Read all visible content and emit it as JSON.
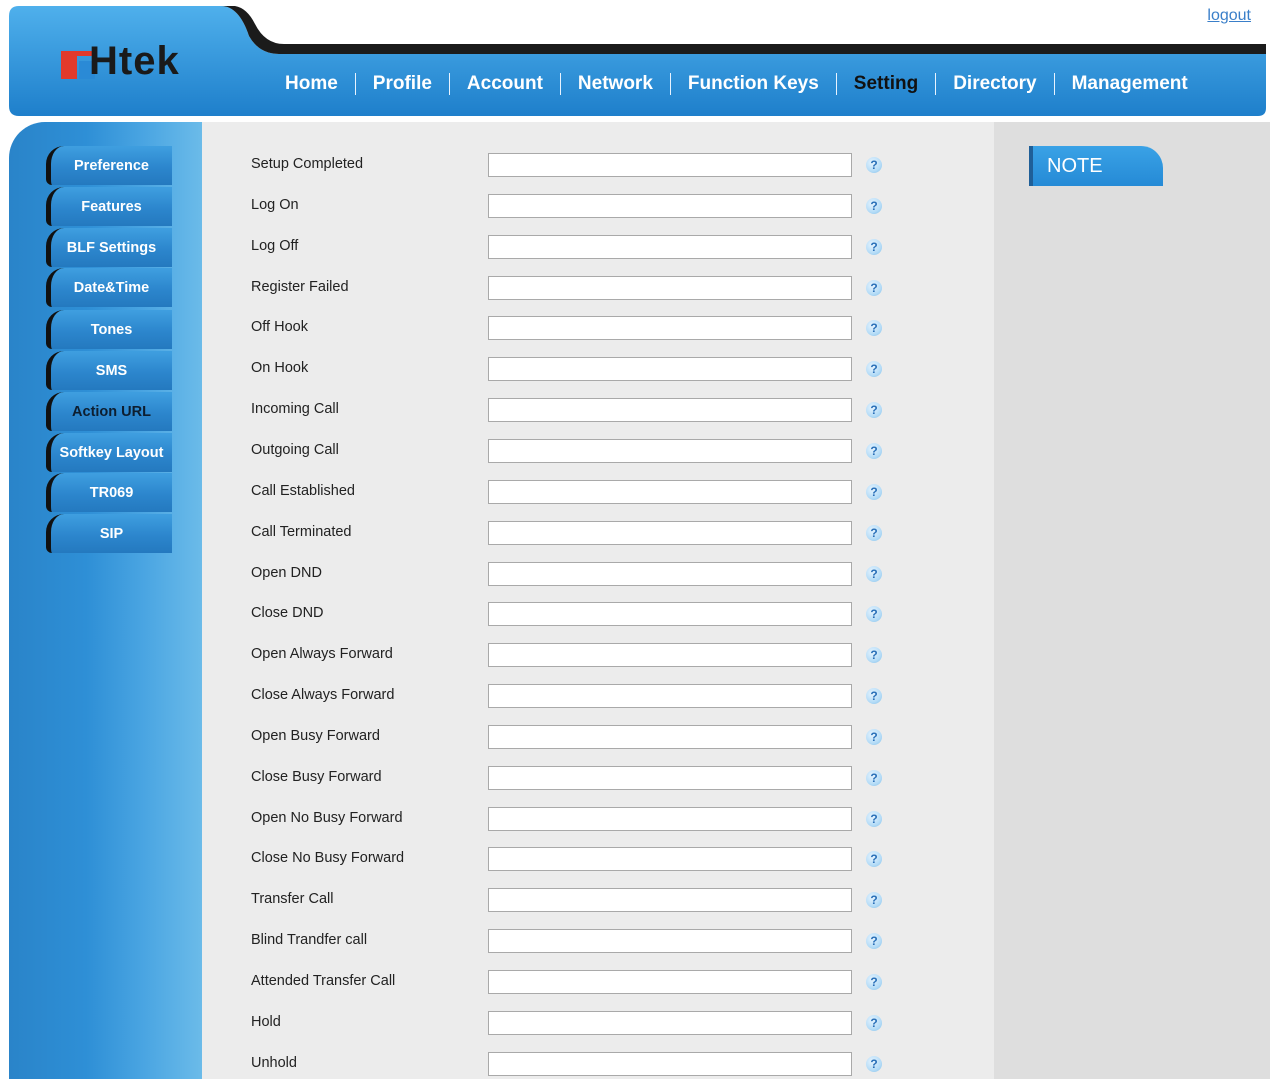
{
  "header": {
    "logout": "logout",
    "logo_text": "Htek",
    "colors": {
      "accent": "#2a8ad6",
      "header_dark": "#1b1b1b"
    }
  },
  "nav": {
    "items": [
      {
        "label": "Home"
      },
      {
        "label": "Profile"
      },
      {
        "label": "Account"
      },
      {
        "label": "Network"
      },
      {
        "label": "Function Keys"
      },
      {
        "label": "Setting",
        "active": true
      },
      {
        "label": "Directory"
      },
      {
        "label": "Management"
      }
    ]
  },
  "sidebar": {
    "items": [
      {
        "label": "Preference"
      },
      {
        "label": "Features"
      },
      {
        "label": "BLF Settings"
      },
      {
        "label": "Date&Time"
      },
      {
        "label": "Tones"
      },
      {
        "label": "SMS"
      },
      {
        "label": "Action URL",
        "active": true
      },
      {
        "label": "Softkey Layout"
      },
      {
        "label": "TR069"
      },
      {
        "label": "SIP"
      }
    ]
  },
  "form": {
    "rows": [
      {
        "label": "Setup Completed",
        "value": ""
      },
      {
        "label": "Log On",
        "value": ""
      },
      {
        "label": "Log Off",
        "value": ""
      },
      {
        "label": "Register Failed",
        "value": ""
      },
      {
        "label": "Off Hook",
        "value": ""
      },
      {
        "label": "On Hook",
        "value": ""
      },
      {
        "label": "Incoming Call",
        "value": ""
      },
      {
        "label": "Outgoing Call",
        "value": ""
      },
      {
        "label": "Call Established",
        "value": ""
      },
      {
        "label": "Call Terminated",
        "value": ""
      },
      {
        "label": "Open DND",
        "value": ""
      },
      {
        "label": "Close DND",
        "value": ""
      },
      {
        "label": "Open Always Forward",
        "value": ""
      },
      {
        "label": "Close Always Forward",
        "value": ""
      },
      {
        "label": "Open Busy Forward",
        "value": ""
      },
      {
        "label": "Close Busy Forward",
        "value": ""
      },
      {
        "label": "Open No Busy Forward",
        "value": ""
      },
      {
        "label": "Close No Busy Forward",
        "value": ""
      },
      {
        "label": "Transfer Call",
        "value": ""
      },
      {
        "label": "Blind Trandfer call",
        "value": ""
      },
      {
        "label": "Attended Transfer Call",
        "value": ""
      },
      {
        "label": "Hold",
        "value": ""
      },
      {
        "label": "Unhold",
        "value": ""
      }
    ],
    "help_icon": "help-icon",
    "help_glyph": "?"
  },
  "note": {
    "title": "NOTE"
  }
}
